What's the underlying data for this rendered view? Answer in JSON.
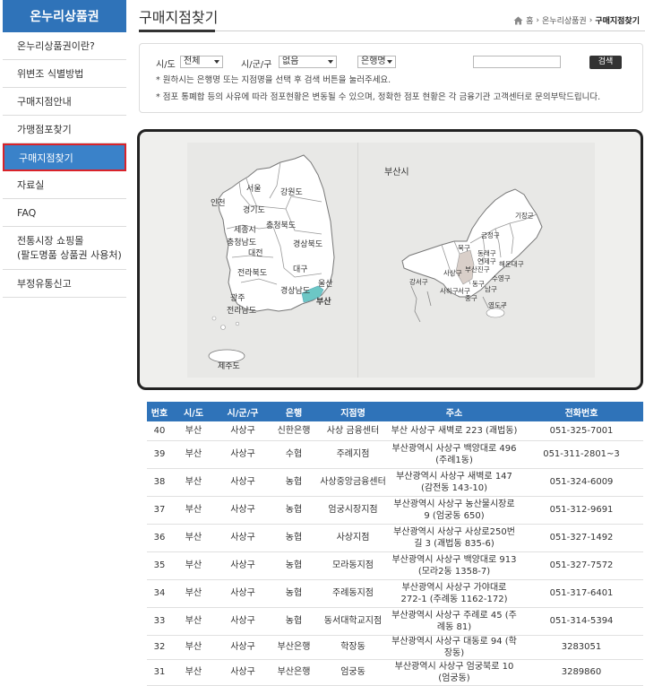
{
  "sidebar": {
    "title": "온누리상품권",
    "items": [
      {
        "label": "온누리상품권이란?"
      },
      {
        "label": "위변조 식별방법"
      },
      {
        "label": "구매지점안내"
      },
      {
        "label": "가맹점포찾기"
      },
      {
        "label": "구매지점찾기",
        "active": true
      },
      {
        "label": "자료실"
      },
      {
        "label": "FAQ"
      },
      {
        "label": "전통시장 쇼핑몰\n(팔도명품 상품권 사용처)"
      },
      {
        "label": "부정유통신고"
      }
    ]
  },
  "header": {
    "title": "구매지점찾기",
    "breadcrumb": [
      "홈",
      "온누리상품권",
      "구매지점찾기"
    ]
  },
  "search": {
    "sido_label": "시/도",
    "sido_value": "전체",
    "sigungu_label": "시/군/구",
    "sigungu_value": "없음",
    "type_value": "은행명",
    "input_value": "",
    "button_label": "검색",
    "note1": "* 원하시는 은행명 또는 지점명을 선택 후 검색 버튼을 눌러주세요.",
    "note2": "* 점포 통폐합 등의 사유에 따라 점포현황은 변동될 수 있으며, 정확한 점포 현황은 각 금융기관 고객센터로 문의부탁드립니다."
  },
  "map": {
    "korea": {
      "regions": [
        "서울",
        "강원도",
        "인천",
        "경기도",
        "충청북도",
        "세종시",
        "충청남도",
        "대전",
        "경상북도",
        "전라북도",
        "대구",
        "울산",
        "경상남도",
        "광주",
        "부산",
        "전라남도",
        "제주도"
      ],
      "selected": "부산",
      "colors": {
        "land": "#ffffff",
        "border": "#777777",
        "selected": "#6cc7c5"
      }
    },
    "busan": {
      "title": "부산시",
      "districts": [
        "기장군",
        "금정구",
        "북구",
        "동래구",
        "연제구",
        "해운대구",
        "부산진구",
        "사상구",
        "수영구",
        "강서구",
        "사하구",
        "서구",
        "동구",
        "남구",
        "중구",
        "영도구"
      ],
      "selected": "사상구",
      "colors": {
        "selected": "#d9cfc9"
      }
    }
  },
  "table": {
    "headers": [
      "번호",
      "시/도",
      "시/군/구",
      "은행",
      "지점명",
      "주소",
      "전화번호"
    ],
    "rows": [
      [
        "40",
        "부산",
        "사상구",
        "신한은행",
        "사상 금융센터",
        "부산 사상구 새벽로 223 (괘법동)",
        "051-325-7001"
      ],
      [
        "39",
        "부산",
        "사상구",
        "수협",
        "주례지점",
        "부산광역시 사상구 백양대로 496 (주례1동)",
        "051-311-2801~3"
      ],
      [
        "38",
        "부산",
        "사상구",
        "농협",
        "사상중앙금융센터",
        "부산광역시 사상구 새벽로 147 (감전동 143-10)",
        "051-324-6009"
      ],
      [
        "37",
        "부산",
        "사상구",
        "농협",
        "엄궁시장지점",
        "부산광역시 사상구 농산물시장로 9 (엄궁동 650)",
        "051-312-9691"
      ],
      [
        "36",
        "부산",
        "사상구",
        "농협",
        "사상지점",
        "부산광역시 사상구 사상로250번길 3 (괘법동 835-6)",
        "051-327-1492"
      ],
      [
        "35",
        "부산",
        "사상구",
        "농협",
        "모라동지점",
        "부산광역시 사상구 백양대로 913 (모라2동 1358-7)",
        "051-327-7572"
      ],
      [
        "34",
        "부산",
        "사상구",
        "농협",
        "주례동지점",
        "부산광역시 사상구 가야대로 272-1 (주례동 1162-172)",
        "051-317-6401"
      ],
      [
        "33",
        "부산",
        "사상구",
        "농협",
        "동서대학교지점",
        "부산광역시 사상구 주례로 45 (주례동 81)",
        "051-314-5394"
      ],
      [
        "32",
        "부산",
        "사상구",
        "부산은행",
        "학장동",
        "부산광역시 사상구 대동로 94 (학장동)",
        "3283051"
      ],
      [
        "31",
        "부산",
        "사상구",
        "부산은행",
        "엄궁동",
        "부산광역시 사상구 엄궁북로 10 (엄궁동)",
        "3289860"
      ]
    ]
  }
}
